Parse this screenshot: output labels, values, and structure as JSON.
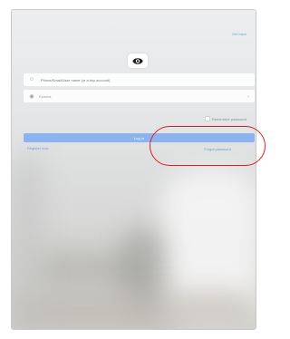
{
  "header": {
    "top_link": "Get back"
  },
  "form": {
    "account_placeholder": "Phone/Email/User name (or a key account)",
    "region_value": "Estonia",
    "remember_label": "Remember password",
    "login_label": "Log in",
    "register_link": "Register now",
    "forgot_link": "Forgot password"
  },
  "icons": {
    "logo": "eye-icon",
    "user": "user-icon",
    "region": "globe-icon",
    "dropdown": "chevron-down-icon"
  },
  "colors": {
    "accent": "#8bb3f0",
    "link": "#6f9ce0",
    "annotation": "#e01e1e"
  }
}
